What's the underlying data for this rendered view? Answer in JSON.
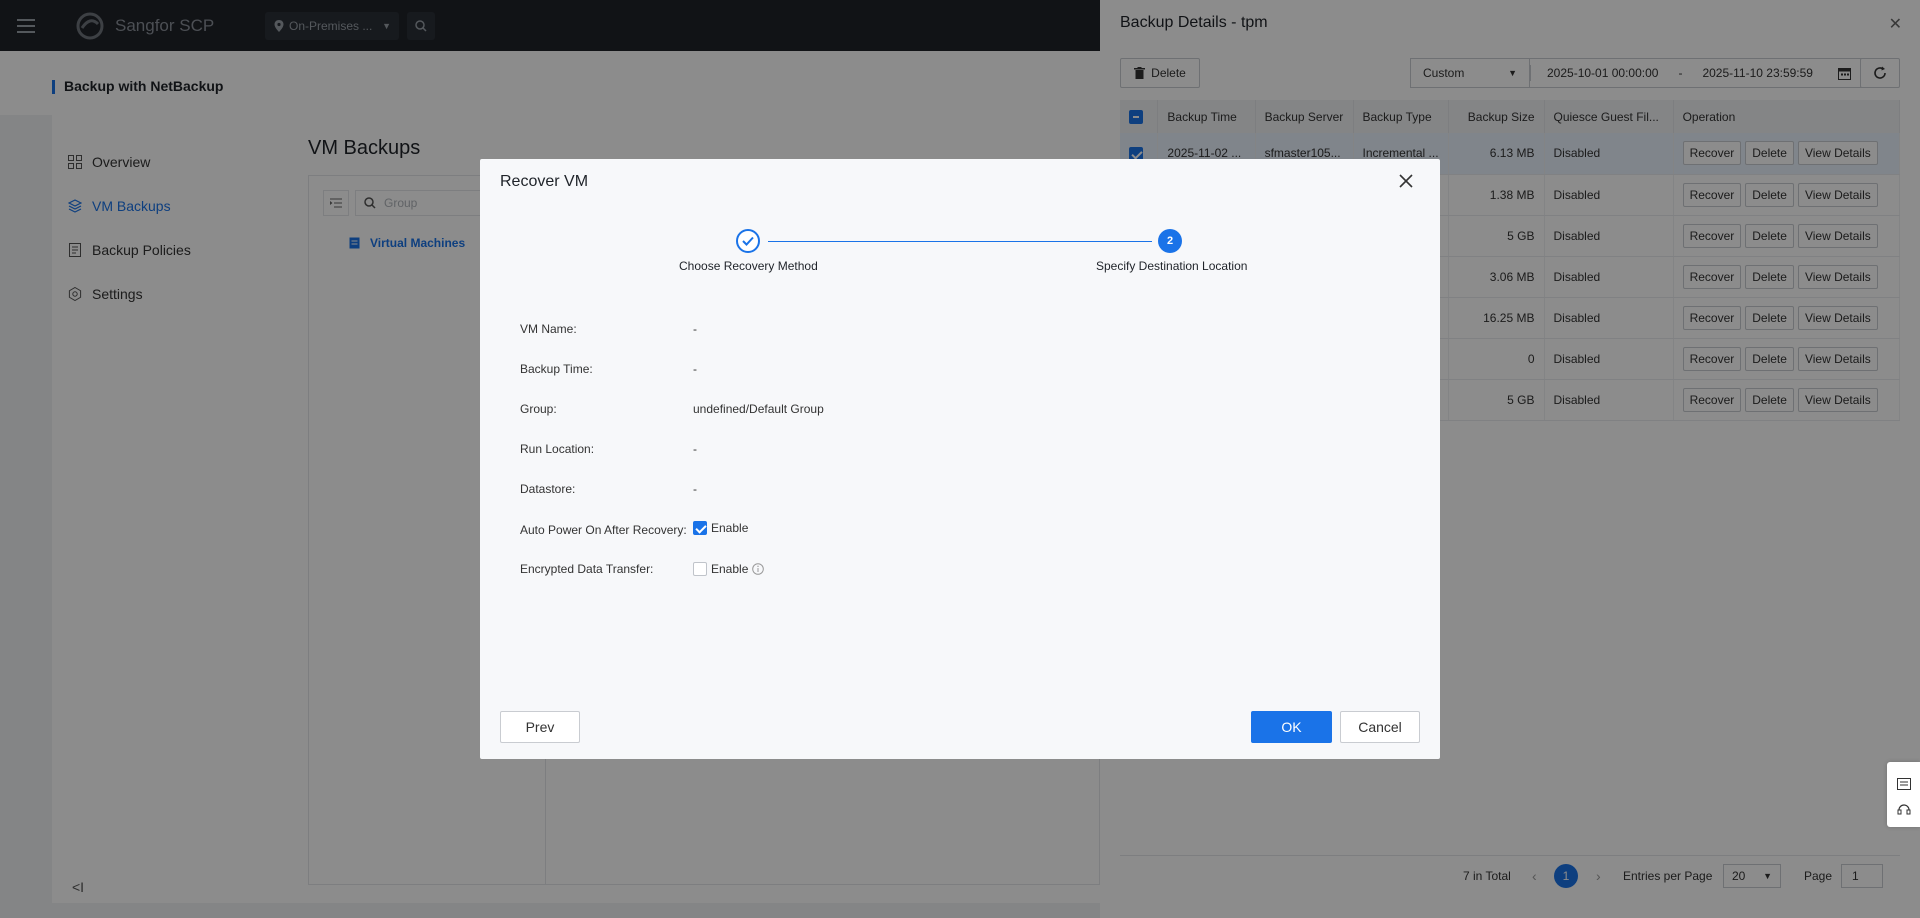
{
  "app": {
    "name": "Sangfor SCP",
    "location": "On-Premises ..."
  },
  "page": {
    "title": "Backup with NetBackup",
    "heading": "VM Backups"
  },
  "nav": {
    "items": [
      {
        "label": "Overview"
      },
      {
        "label": "VM Backups"
      },
      {
        "label": "Backup Policies"
      },
      {
        "label": "Settings"
      }
    ],
    "collapse": "<I"
  },
  "tree": {
    "search_placeholder": "Group",
    "node": "Virtual Machines"
  },
  "drawer": {
    "title": "Backup Details - tpm",
    "delete_label": "Delete",
    "range_mode": "Custom",
    "range_start": "2025-10-01 00:00:00",
    "range_sep": "-",
    "range_end": "2025-11-10 23:59:59",
    "columns": [
      "Backup Time",
      "Backup Server",
      "Backup Type",
      "Backup Size",
      "Quiesce Guest Fil...",
      "Operation"
    ],
    "rows": [
      {
        "time": "2025-11-02 ...",
        "server": "sfmaster105...",
        "type": "Incremental ...",
        "size": "6.13 MB",
        "quiesce": "Disabled"
      },
      {
        "time": "",
        "server": "",
        "type": "",
        "size": "1.38 MB",
        "quiesce": "Disabled"
      },
      {
        "time": "",
        "server": "",
        "type": "",
        "size": "5 GB",
        "quiesce": "Disabled"
      },
      {
        "time": "",
        "server": "",
        "type": "",
        "size": "3.06 MB",
        "quiesce": "Disabled"
      },
      {
        "time": "",
        "server": "",
        "type": "",
        "size": "16.25 MB",
        "quiesce": "Disabled"
      },
      {
        "time": "",
        "server": "",
        "type": "",
        "size": "0",
        "quiesce": "Disabled"
      },
      {
        "time": "",
        "server": "",
        "type": "",
        "size": "5 GB",
        "quiesce": "Disabled"
      }
    ],
    "ops": {
      "recover": "Recover",
      "delete": "Delete",
      "view": "View Details"
    },
    "pager": {
      "total": "7 in Total",
      "prev": "‹",
      "current_page": "1",
      "next": "›",
      "per_page_label": "Entries per Page",
      "per_page": "20",
      "page_label": "Page",
      "page_input": "1"
    }
  },
  "modal": {
    "title": "Recover VM",
    "step1": "Choose Recovery Method",
    "step2_num": "2",
    "step2": "Specify Destination Location",
    "fields": {
      "vm_name_label": "VM Name:",
      "vm_name": "-",
      "backup_time_label": "Backup Time:",
      "backup_time": "-",
      "group_label": "Group:",
      "group": "undefined/Default Group",
      "run_location_label": "Run Location:",
      "run_location": "-",
      "datastore_label": "Datastore:",
      "datastore": "-",
      "auto_power_label": "Auto Power On After Recovery:",
      "auto_power_option": "Enable",
      "encrypted_label": "Encrypted Data Transfer:",
      "encrypted_option": "Enable"
    },
    "prev": "Prev",
    "ok": "OK",
    "cancel": "Cancel"
  },
  "colors": {
    "accent": "#1a73e8",
    "topbar": "#1f2329"
  }
}
